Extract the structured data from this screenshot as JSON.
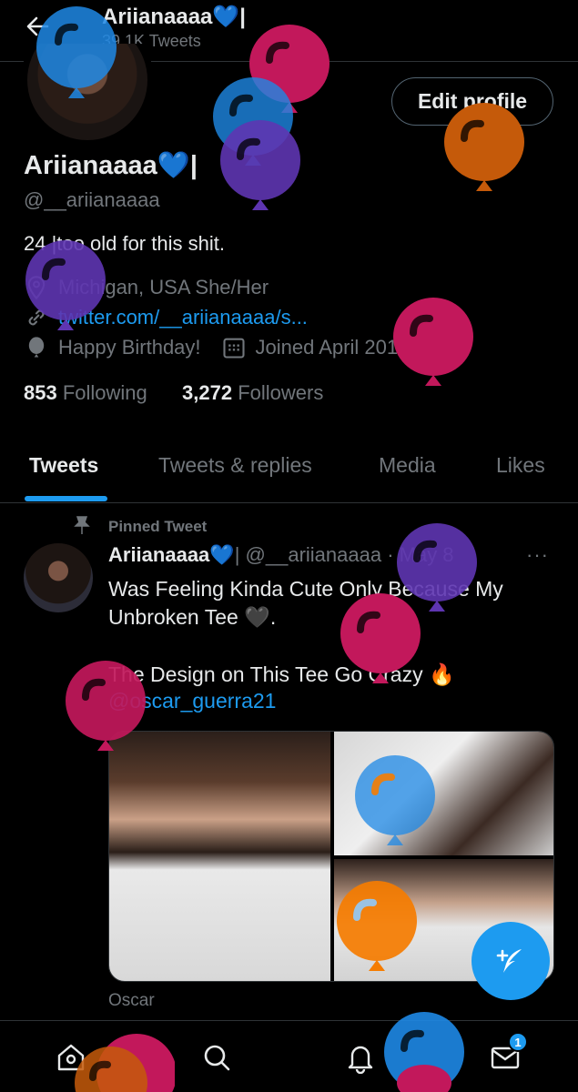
{
  "header": {
    "name": "Ariianaaaa",
    "tweet_count": "39.1K Tweets"
  },
  "profile": {
    "edit_label": "Edit profile",
    "name": "Ariianaaaa",
    "handle": "@__ariianaaaa",
    "bio": "24 |too old for this shit.",
    "location": "Michigan, USA She/Her",
    "link": "twitter.com/__ariianaaaa/s...",
    "birthday": "Happy Birthday!",
    "joined": "Joined April 2011",
    "following_count": "853",
    "following_label": "Following",
    "followers_count": "3,272",
    "followers_label": "Followers"
  },
  "tabs": [
    {
      "label": "Tweets"
    },
    {
      "label": "Tweets & replies"
    },
    {
      "label": "Media"
    },
    {
      "label": "Likes"
    }
  ],
  "tweet": {
    "pinned_label": "Pinned Tweet",
    "name": "Ariianaaaa",
    "handle_date": "@__ariianaaaa · May 8",
    "more": "···",
    "text_line1": "Was Feeling Kinda Cute Only Because My Unbroken Tee",
    "text_end": ".",
    "text_line2": "The Design on This Tee Go Crazy",
    "mention": "@oscar_guerra21",
    "caption": "Oscar"
  },
  "nav": {
    "messages_badge": "1"
  },
  "colors": {
    "accent": "#1d9bf0",
    "heart": "#5aa9e6",
    "balloon_pink": "#c2185b",
    "balloon_purple": "#5e35b1",
    "balloon_blue": "#1e88e5",
    "balloon_orange": "#f57c00"
  }
}
